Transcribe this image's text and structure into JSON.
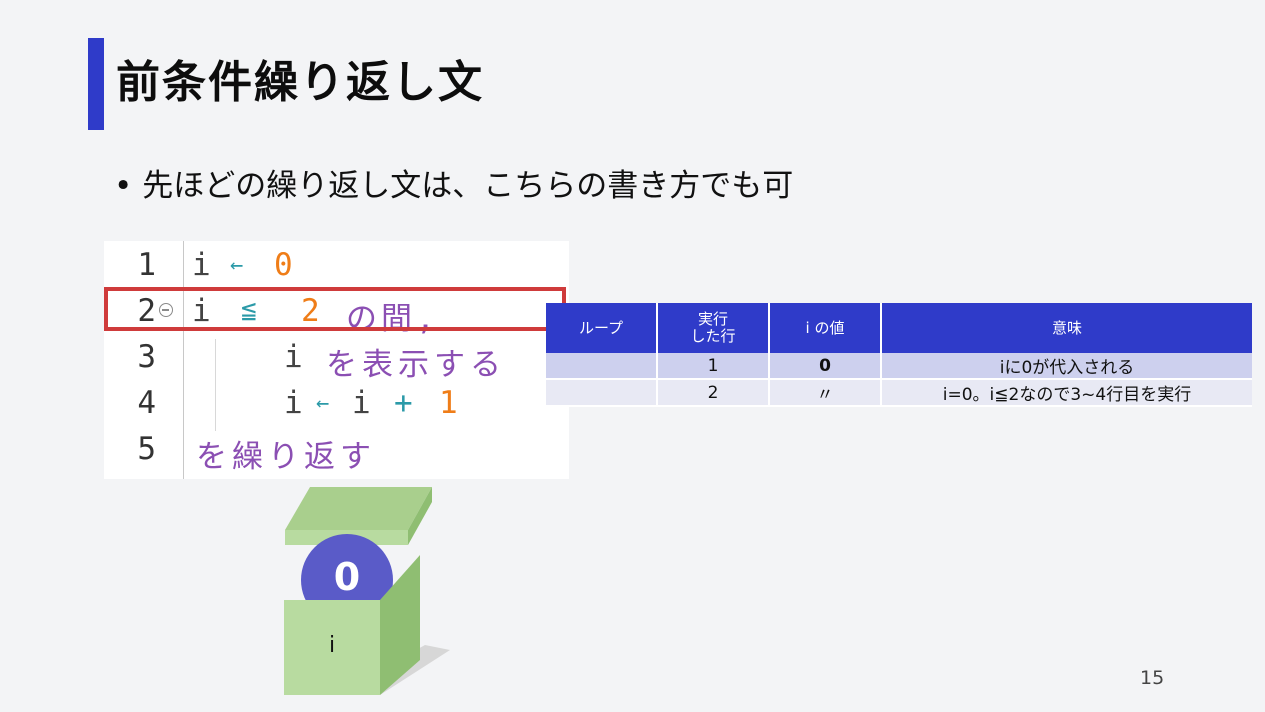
{
  "slide": {
    "title": "前条件繰り返し文",
    "bullet_dot": "•",
    "bullet_text": "先ほどの繰り返し文は、こちらの書き方でも可",
    "page_number": "15"
  },
  "code": {
    "lines": [
      {
        "num": "1",
        "t1": "i",
        "t2": "←",
        "t3": "0"
      },
      {
        "num": "2",
        "t1": "i",
        "t2": "≦",
        "t3": "2",
        "t4": "の間,"
      },
      {
        "num": "3",
        "t1": "i",
        "t2": "を表示する"
      },
      {
        "num": "4",
        "t1": "i",
        "t2": "←",
        "t3": "i",
        "t4": "+",
        "t5": "1"
      },
      {
        "num": "5",
        "t1": "を繰り返す"
      }
    ]
  },
  "trace_table": {
    "headers": [
      "ループ",
      "実行\nした行",
      "i の値",
      "意味"
    ],
    "header_line1": "実行",
    "header_line2": "した行",
    "rows": [
      {
        "loop": "",
        "line": "1",
        "value": "0",
        "meaning": "iに0が代入される"
      },
      {
        "loop": "",
        "line": "2",
        "value": "〃",
        "meaning": "i=0。i≦2なので3~4行目を実行"
      }
    ]
  },
  "variable_box": {
    "value": "0",
    "label": "i"
  },
  "colors": {
    "accent": "#2f3bc9",
    "highlight_border": "#cf3b3b",
    "number": "#ef7d18",
    "keyword": "#8b4fb3",
    "operator": "#2b9aa8"
  }
}
